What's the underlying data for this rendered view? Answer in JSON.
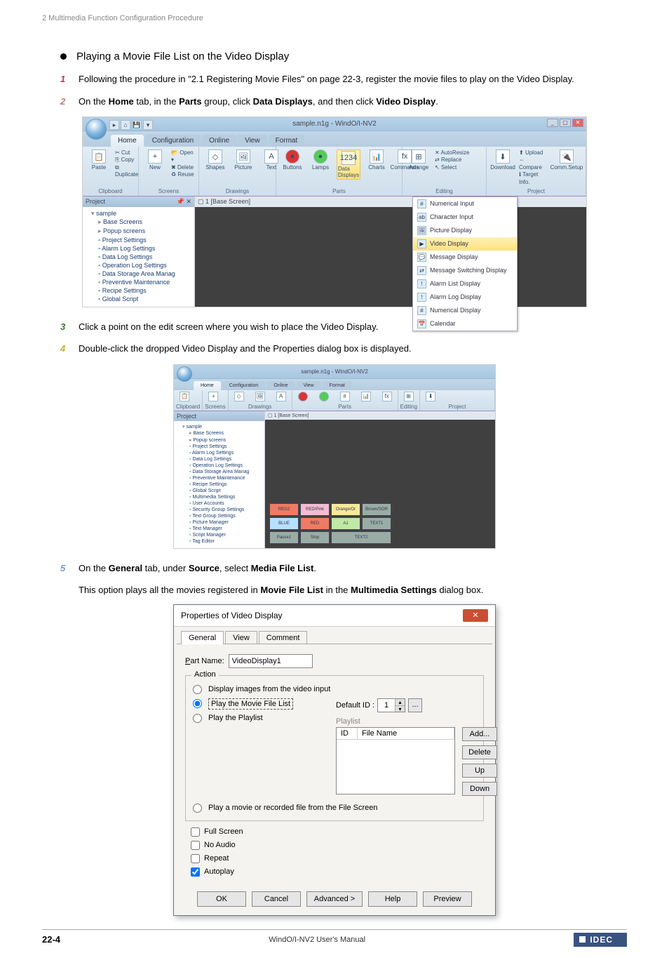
{
  "header": {
    "section": "2 Multimedia Function Configuration Procedure"
  },
  "heading1": "Playing a Movie File List on the Video Display",
  "steps": {
    "s1": "Following the procedure in \"2.1 Registering Movie Files\" on page 22-3, register the movie files to play on the Video Display.",
    "s2_pre": "On the ",
    "s2_home": "Home",
    "s2_mid1": " tab, in the ",
    "s2_parts": "Parts",
    "s2_mid2": " group, click ",
    "s2_dd": "Data Displays",
    "s2_mid3": ", and then click ",
    "s2_vd": "Video Display",
    "s2_end": ".",
    "s3": "Click a point on the edit screen where you wish to place the Video Display.",
    "s4": "Double-click the dropped Video Display and the Properties dialog box is displayed.",
    "s5_pre": "On the ",
    "s5_gen": "General",
    "s5_mid1": " tab, under ",
    "s5_src": "Source",
    "s5_mid2": ", select ",
    "s5_mfl": "Media File List",
    "s5_end": ".",
    "s5_sub_pre": "This option plays all the movies registered in ",
    "s5_sub_mfl": "Movie File List",
    "s5_sub_mid": " in the ",
    "s5_sub_ms": "Multimedia Settings",
    "s5_sub_end": " dialog box."
  },
  "ribbon1": {
    "title": "sample.n1g - WindO/I-NV2",
    "tabs": [
      "Home",
      "Configuration",
      "Online",
      "View",
      "Format"
    ],
    "groups": {
      "clipboard": "Clipboard",
      "screens": "Screens",
      "drawings": "Drawings",
      "parts": "Parts",
      "editing": "Editing",
      "project": "Project"
    },
    "clipboard_items": {
      "cut": "Cut",
      "copy": "Copy",
      "paste": "Paste",
      "duplicate": "Duplicate"
    },
    "screens_items": {
      "new": "New",
      "open": "Open",
      "delete": "Delete",
      "reuse": "Reuse"
    },
    "drawings_items": {
      "shapes": "Shapes",
      "picture": "Picture",
      "text": "Text",
      "a": "A"
    },
    "parts_items": {
      "buttons": "Buttons",
      "lamps": "Lamps",
      "data": "Data Displays",
      "charts": "Charts",
      "commands": "Commands",
      "num": "1234",
      "fx": "fx"
    },
    "editing_items": {
      "arrange": "Arrange",
      "autoresize": "AutoResize",
      "replace": "Replace",
      "select": "Select"
    },
    "project_items": {
      "download": "Download",
      "upload": "Upload",
      "compare": "Compare",
      "target": "Target Info.",
      "comm": "Comm.Setup"
    },
    "tree_title": "Project",
    "tree": {
      "root": "sample",
      "base": "Base Screens",
      "popup": "Popup screens",
      "proj": "Project Settings",
      "alarm": "Alarm Log Settings",
      "datalog": "Data Log Settings",
      "oplog": "Operation Log Settings",
      "storage": "Data Storage Area Manag",
      "prev": "Preventive Maintenance",
      "recipe": "Recipe Settings",
      "global": "Global Script"
    },
    "canvas_tab": "1 [Base Screen]",
    "menu": {
      "numin": "Numerical Input",
      "charin": "Character Input",
      "picdisp": "Picture Display",
      "viddisp": "Video Display",
      "msgdisp": "Message Display",
      "msgsw": "Message Switching Display",
      "alarmlist": "Alarm List Display",
      "alarmlog": "Alarm Log Display",
      "numdisp": "Numerical Display",
      "cal": "Calendar"
    }
  },
  "ribbon2_tree_extra": {
    "multim": "Multimedia Settings",
    "useracc": "User Accounts",
    "secgrp": "Security Group Settings",
    "textgrp": "Text Group Settings",
    "picman": "Picture Manager",
    "textman": "Text Manager",
    "scriptman": "Script Manager",
    "tageditor": "Tag Editor"
  },
  "thumbs": [
    "REG2",
    "RED/Pink",
    "Orange/Or",
    "Brown/SOR",
    "BLUE",
    "RED",
    "A1",
    "TEXT1",
    "Pause1",
    "Stop",
    "TEXT2"
  ],
  "dlg": {
    "title": "Properties of Video Display",
    "tabs": [
      "General",
      "View",
      "Comment"
    ],
    "partname_label": "Part Name:",
    "partname_val": "VideoDisplay1",
    "action": "Action",
    "r1": "Display images from the video input",
    "r2": "Play the Movie File List",
    "r3": "Play the Playlist",
    "defid": "Default ID :",
    "defid_val": "1",
    "playlist": "Playlist",
    "col_id": "ID",
    "col_fn": "File Name",
    "btn_add": "Add...",
    "btn_del": "Delete",
    "btn_up": "Up",
    "btn_down": "Down",
    "r4": "Play a movie or recorded file from the File Screen",
    "c1": "Full Screen",
    "c2": "No Audio",
    "c3": "Repeat",
    "c4": "Autoplay",
    "ok": "OK",
    "cancel": "Cancel",
    "adv": "Advanced >",
    "help": "Help",
    "preview": "Preview"
  },
  "footer": {
    "page": "22-4",
    "manual": "WindO/I-NV2 User's Manual",
    "brand": "IDEC"
  }
}
